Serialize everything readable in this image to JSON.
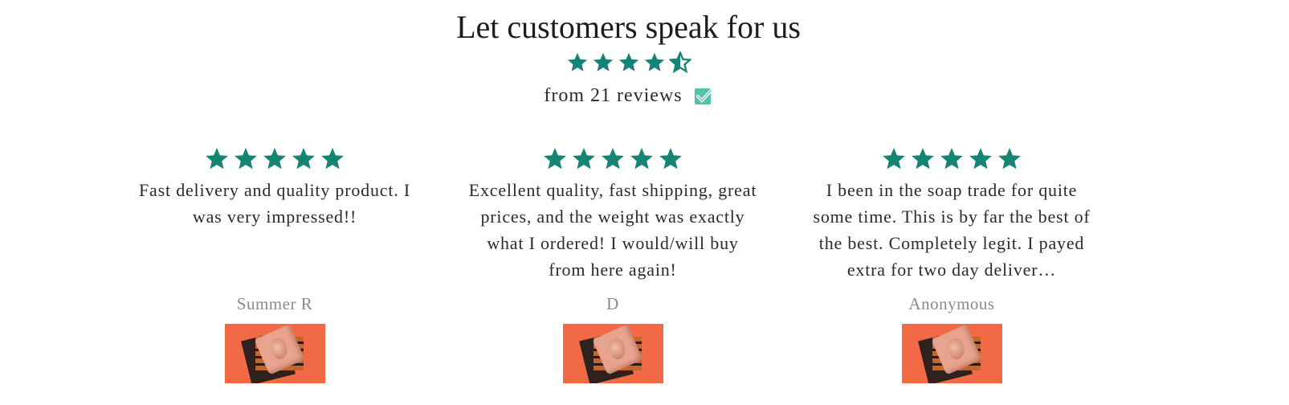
{
  "header": {
    "title": "Let customers speak for us",
    "summary_rating": 4.5,
    "summary_text": "from 21 reviews",
    "verified_icon": "verified-check-icon"
  },
  "colors": {
    "star": "#148474",
    "badge": "#4fc4a8"
  },
  "reviews": [
    {
      "rating": 5,
      "text": "Fast delivery and quality product. I was very impressed!!",
      "author": "Summer R"
    },
    {
      "rating": 5,
      "text": "Excellent quality, fast shipping, great prices, and the weight was exactly what I ordered! I would/will buy from here again!",
      "author": "D"
    },
    {
      "rating": 5,
      "text": "I been in the soap trade for quite some time. This is by far the best of the best. Completely legit. I payed extra for two day deliver…",
      "author": "Anonymous"
    }
  ]
}
